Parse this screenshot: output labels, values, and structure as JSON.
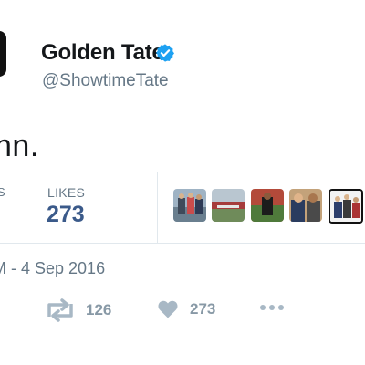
{
  "tweet": {
    "display_name": "Golden Tate",
    "handle": "@ShowtimeTate",
    "verified_icon": "verified-badge-icon",
    "text": "nn.",
    "timestamp": "M - 4 Sep 2016"
  },
  "stats": {
    "retweets_label_partial": "S",
    "likes_label": "LIKES",
    "likes_count": "273",
    "liker_avatars": [
      "liker-avatar-1",
      "liker-avatar-2",
      "liker-avatar-3",
      "liker-avatar-4",
      "liker-avatar-5"
    ]
  },
  "actions": {
    "reply_icon": "reply-icon",
    "retweet_icon": "retweet-icon",
    "retweet_count": "126",
    "like_icon": "heart-icon",
    "like_count": "273",
    "more_icon": "more-dots-icon"
  },
  "colors": {
    "verified_blue": "#1da1f2",
    "likes_count": "#3b5a8a",
    "muted_text": "#657786",
    "action_icon": "#a8b8c5"
  }
}
